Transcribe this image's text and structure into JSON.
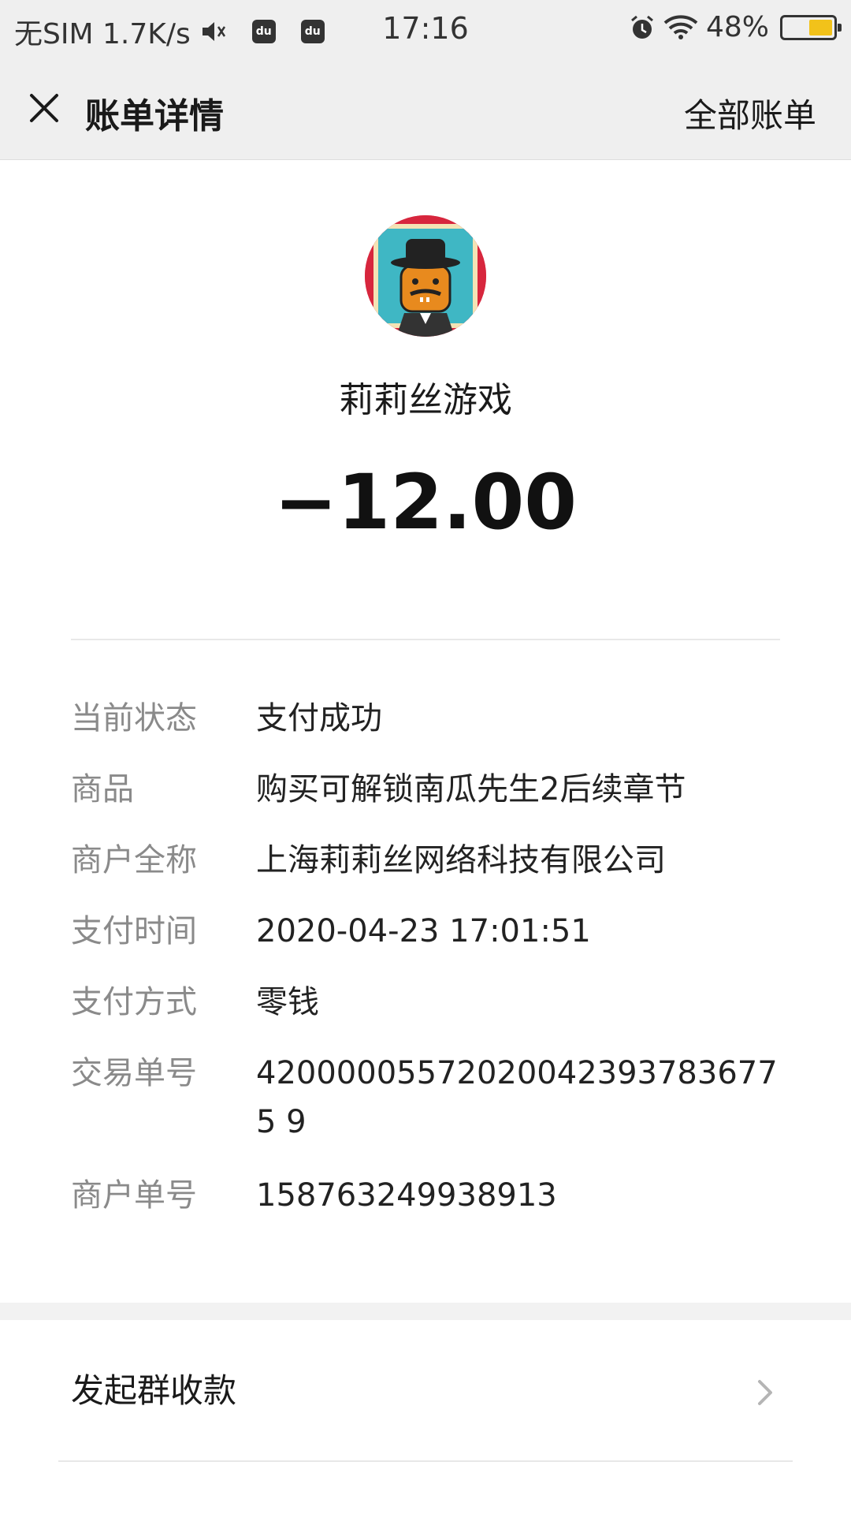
{
  "status_bar": {
    "left_text": "无SIM 1.7K/s",
    "du_label": "du",
    "time": "17:16",
    "battery": "48%",
    "battery_level": 0.48,
    "battery_color": "#f2c21a"
  },
  "nav": {
    "title": "账单详情",
    "right_link": "全部账单"
  },
  "merchant": {
    "name": "莉莉丝游戏",
    "amount": "−12.00"
  },
  "details": [
    {
      "label": "当前状态",
      "value": "支付成功"
    },
    {
      "label": "商品",
      "value": "购买可解锁南瓜先生2后续章节"
    },
    {
      "label": "商户全称",
      "value": "上海莉莉丝网络科技有限公司"
    },
    {
      "label": "支付时间",
      "value": "2020-04-23 17:01:51"
    },
    {
      "label": "支付方式",
      "value": "零钱"
    },
    {
      "label": "交易单号",
      "value": "420000055720200423937836775 9"
    },
    {
      "label": "商户单号",
      "value": "158763249938913"
    }
  ],
  "actions": {
    "group_collect": "发起群收款"
  },
  "colors": {
    "header_bg": "#efefef",
    "label_gray": "#8a8a8a",
    "text": "#1a1a1a"
  }
}
